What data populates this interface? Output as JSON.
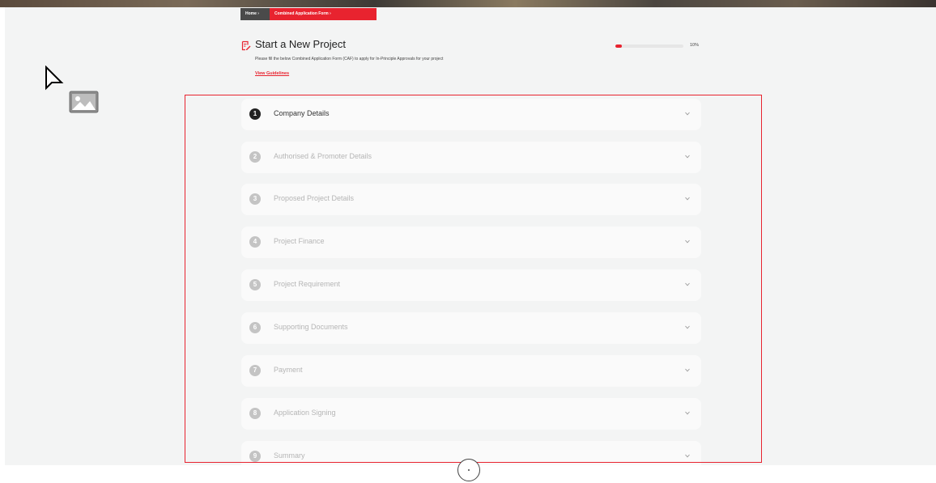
{
  "breadcrumb": {
    "home": "Home ›",
    "current": "Combined Application Form ›"
  },
  "header": {
    "icon": "document-pen-icon",
    "title": "Start a New Project",
    "subtitle": "Please fill the below Combined Application Form (CAF) to apply for In-Principle Approvals for your project",
    "guidelines_link": "View Guidelines"
  },
  "progress": {
    "percent": 10,
    "label": "10%"
  },
  "sections": [
    {
      "number": "1",
      "title": "Company Details",
      "state": "active"
    },
    {
      "number": "2",
      "title": "Authorised & Promoter Details",
      "state": "disabled"
    },
    {
      "number": "3",
      "title": "Proposed Project Details",
      "state": "disabled"
    },
    {
      "number": "4",
      "title": "Project Finance",
      "state": "disabled"
    },
    {
      "number": "5",
      "title": "Project Requirement",
      "state": "disabled"
    },
    {
      "number": "6",
      "title": "Supporting Documents",
      "state": "disabled"
    },
    {
      "number": "7",
      "title": "Payment",
      "state": "disabled"
    },
    {
      "number": "8",
      "title": "Application Signing",
      "state": "disabled"
    },
    {
      "number": "9",
      "title": "Summary",
      "state": "disabled"
    }
  ],
  "colors": {
    "accent": "#e8232f",
    "active_number": "#222222",
    "disabled_number": "#c4c4c4"
  },
  "icons": {
    "cursor": "mouse-pointer-icon",
    "image_placeholder": "image-placeholder-icon",
    "chevron": "chevron-down-icon",
    "scroll": "scroll-indicator-icon"
  }
}
